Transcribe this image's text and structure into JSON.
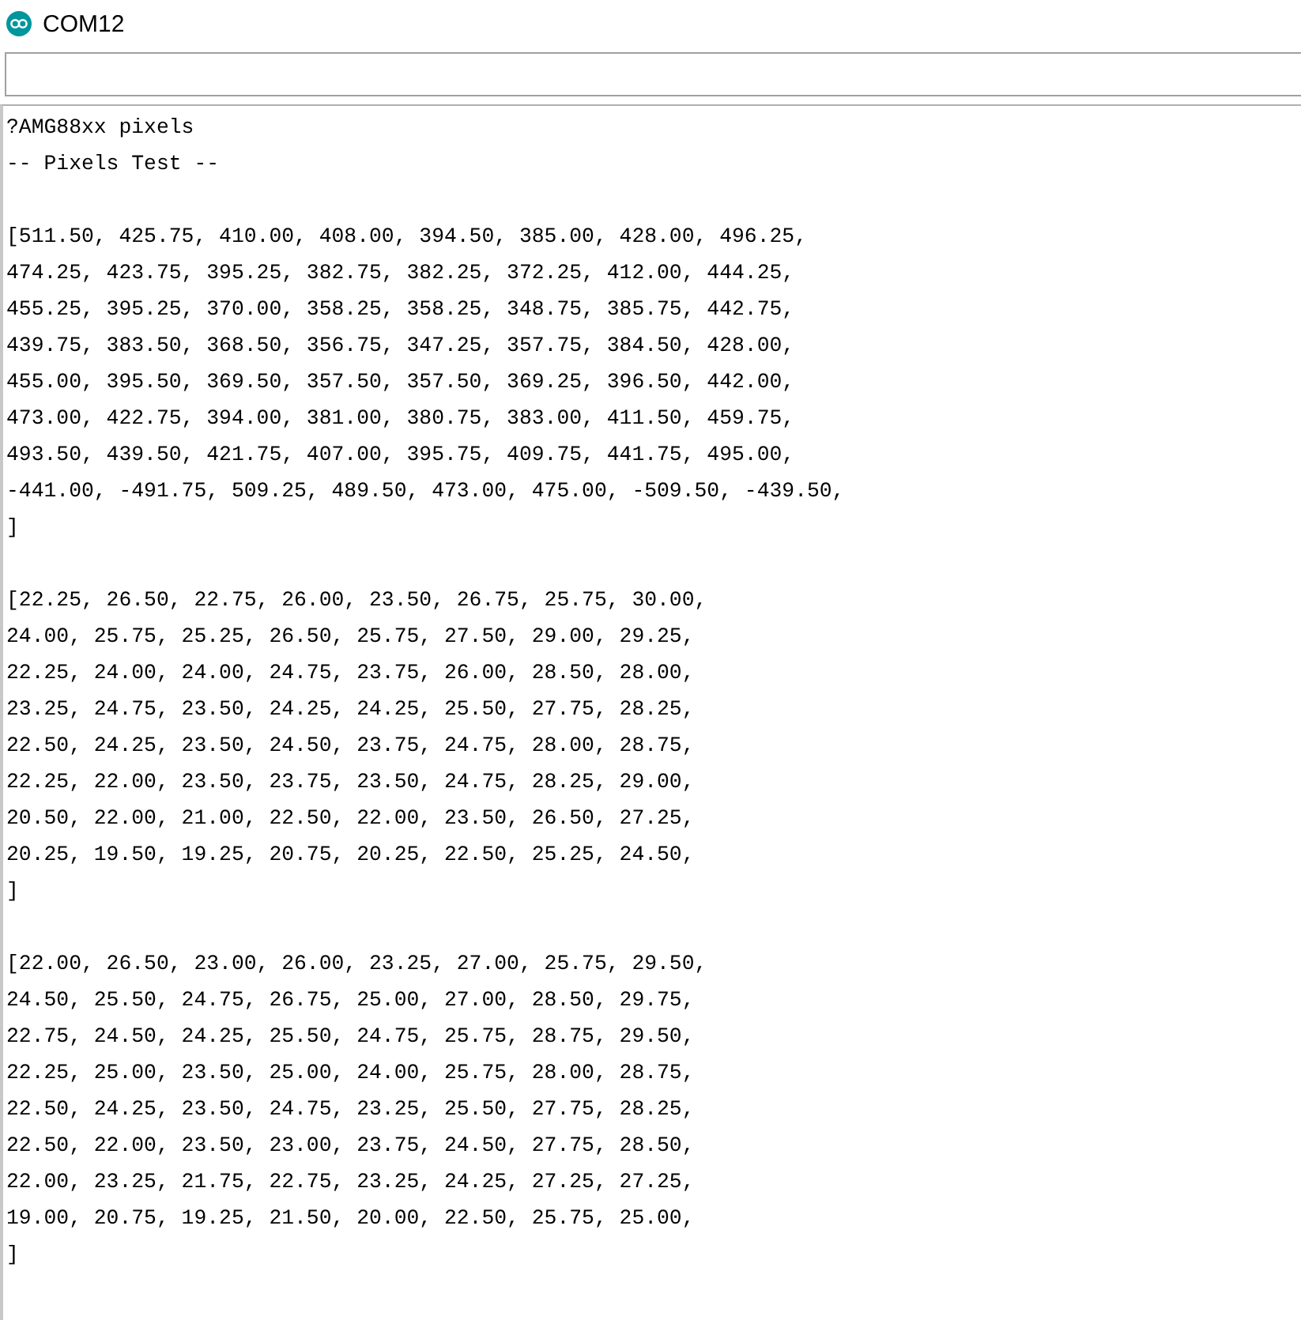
{
  "window": {
    "title": "COM12"
  },
  "output": {
    "blocks": [
      [
        "?AMG88xx pixels",
        "-- Pixels Test --"
      ],
      [
        "[511.50, 425.75, 410.00, 408.00, 394.50, 385.00, 428.00, 496.25,",
        "474.25, 423.75, 395.25, 382.75, 382.25, 372.25, 412.00, 444.25,",
        "455.25, 395.25, 370.00, 358.25, 358.25, 348.75, 385.75, 442.75,",
        "439.75, 383.50, 368.50, 356.75, 347.25, 357.75, 384.50, 428.00,",
        "455.00, 395.50, 369.50, 357.50, 357.50, 369.25, 396.50, 442.00,",
        "473.00, 422.75, 394.00, 381.00, 380.75, 383.00, 411.50, 459.75,",
        "493.50, 439.50, 421.75, 407.00, 395.75, 409.75, 441.75, 495.00,",
        "-441.00, -491.75, 509.25, 489.50, 473.00, 475.00, -509.50, -439.50,",
        "]"
      ],
      [
        "[22.25, 26.50, 22.75, 26.00, 23.50, 26.75, 25.75, 30.00,",
        "24.00, 25.75, 25.25, 26.50, 25.75, 27.50, 29.00, 29.25,",
        "22.25, 24.00, 24.00, 24.75, 23.75, 26.00, 28.50, 28.00,",
        "23.25, 24.75, 23.50, 24.25, 24.25, 25.50, 27.75, 28.25,",
        "22.50, 24.25, 23.50, 24.50, 23.75, 24.75, 28.00, 28.75,",
        "22.25, 22.00, 23.50, 23.75, 23.50, 24.75, 28.25, 29.00,",
        "20.50, 22.00, 21.00, 22.50, 22.00, 23.50, 26.50, 27.25,",
        "20.25, 19.50, 19.25, 20.75, 20.25, 22.50, 25.25, 24.50,",
        "]"
      ],
      [
        "[22.00, 26.50, 23.00, 26.00, 23.25, 27.00, 25.75, 29.50,",
        "24.50, 25.50, 24.75, 26.75, 25.00, 27.00, 28.50, 29.75,",
        "22.75, 24.50, 24.25, 25.50, 24.75, 25.75, 28.75, 29.50,",
        "22.25, 25.00, 23.50, 25.00, 24.00, 25.75, 28.00, 28.75,",
        "22.50, 24.25, 23.50, 24.75, 23.25, 25.50, 27.75, 28.25,",
        "22.50, 22.00, 23.50, 23.00, 23.75, 24.50, 27.75, 28.50,",
        "22.00, 23.25, 21.75, 22.75, 23.25, 24.25, 27.25, 27.25,",
        "19.00, 20.75, 19.25, 21.50, 20.00, 22.50, 25.75, 25.00,",
        "]"
      ]
    ]
  }
}
